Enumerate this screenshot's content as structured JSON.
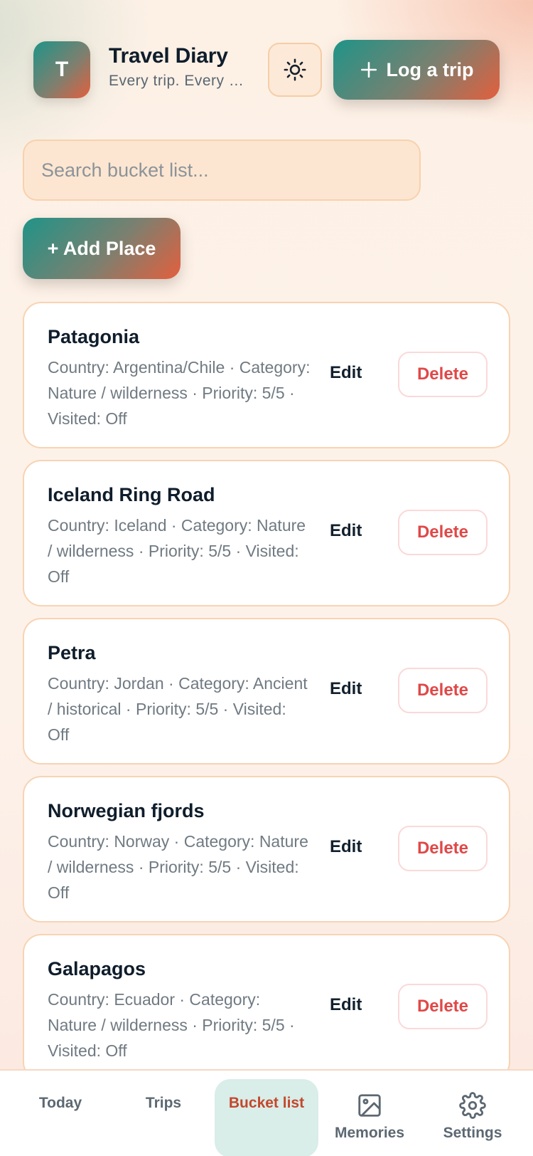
{
  "header": {
    "avatar_letter": "T",
    "title": "Travel Diary",
    "subtitle": "Every trip. Every moment.",
    "theme_icon": "sun-icon",
    "log_trip_label": "Log a trip",
    "log_trip_icon": "plus-icon"
  },
  "search": {
    "placeholder": "Search bucket list...",
    "value": ""
  },
  "add_place_label": "+ Add Place",
  "places": [
    {
      "name": "Patagonia",
      "meta": "Country: Argentina/Chile · Category: Nature / wilderness · Priority: 5/5 · Visited: Off",
      "edit": "Edit",
      "delete": "Delete"
    },
    {
      "name": "Iceland Ring Road",
      "meta": "Country: Iceland · Category: Nature / wilderness · Priority: 5/5 · Visited: Off",
      "edit": "Edit",
      "delete": "Delete"
    },
    {
      "name": "Petra",
      "meta": "Country: Jordan · Category: Ancient / historical · Priority: 5/5 · Visited: Off",
      "edit": "Edit",
      "delete": "Delete"
    },
    {
      "name": "Norwegian fjords",
      "meta": "Country: Norway · Category: Nature / wilderness · Priority: 5/5 · Visited: Off",
      "edit": "Edit",
      "delete": "Delete"
    },
    {
      "name": "Galapagos",
      "meta": "Country: Ecuador · Category: Nature / wilderness · Priority: 5/5 · Visited: Off",
      "edit": "Edit",
      "delete": "Delete"
    }
  ],
  "nav": {
    "today": "Today",
    "trips": "Trips",
    "bucket_list": "Bucket list",
    "memories": "Memories",
    "settings": "Settings",
    "active": "bucket_list"
  },
  "colors": {
    "accent_start": "#1f9488",
    "accent_end": "#e35f3d",
    "delete_red": "#e04848",
    "active_tab": "#c4472c"
  }
}
